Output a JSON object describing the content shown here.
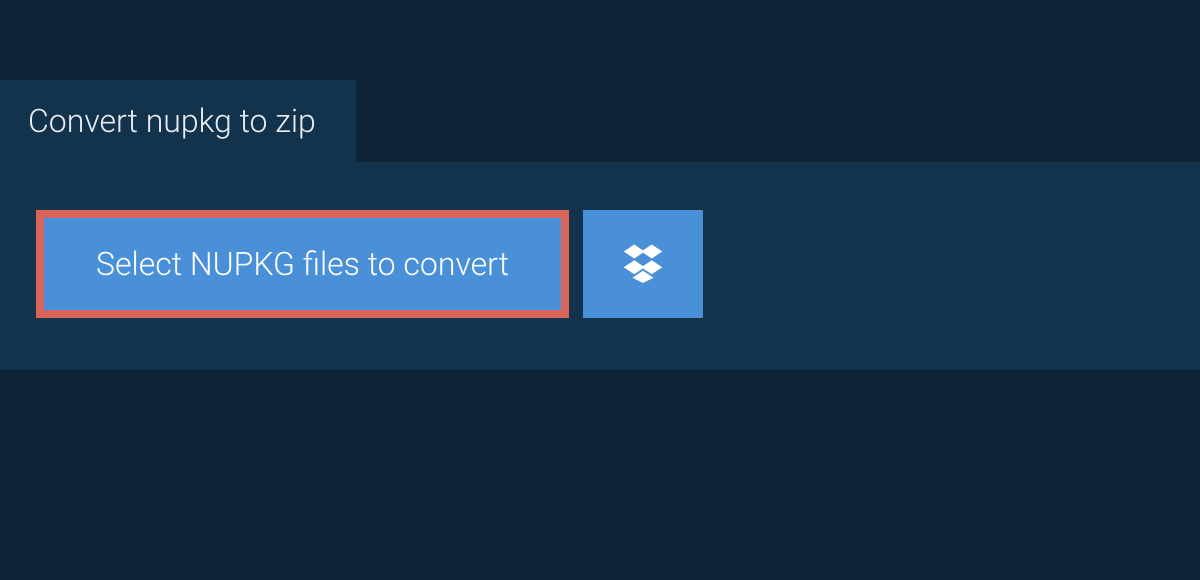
{
  "tab": {
    "label": "Convert nupkg to zip"
  },
  "actions": {
    "select_label": "Select NUPKG files to convert"
  },
  "colors": {
    "background": "#0d2438",
    "panel": "#13334d",
    "button": "#4a90d9",
    "highlight_border": "#d96459"
  }
}
